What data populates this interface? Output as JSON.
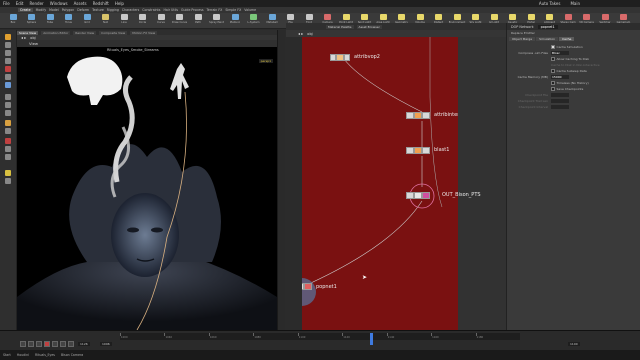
{
  "menubar": {
    "items": [
      "File",
      "Edit",
      "Render",
      "Windows",
      "Assets",
      "Redshift",
      "Help"
    ],
    "right": [
      "Auto Takes",
      "Main"
    ]
  },
  "shelf_tabs": [
    "Create",
    "Modify",
    "Model",
    "Polygon",
    "Deform",
    "Texture",
    "Rigging",
    "Characters",
    "Constraints",
    "Hair Utils",
    "Guide Process",
    "Terrain FX",
    "Simple FX",
    "Volume"
  ],
  "shelf_tools": [
    {
      "label": "Box",
      "color": "#6aa6d8"
    },
    {
      "label": "Sphere",
      "color": "#6aa6d8"
    },
    {
      "label": "Tube",
      "color": "#6aa6d8"
    },
    {
      "label": "Torus",
      "color": "#6aa6d8"
    },
    {
      "label": "Grid",
      "color": "#6aa6d8"
    },
    {
      "label": "Null",
      "color": "#d8c36a"
    },
    {
      "label": "Line",
      "color": "#c8c8c8"
    },
    {
      "label": "Circle",
      "color": "#c8c8c8"
    },
    {
      "label": "Curve",
      "color": "#c8c8c8"
    },
    {
      "label": "Draw Curve",
      "color": "#c8c8c8"
    },
    {
      "label": "Path",
      "color": "#c8c8c8"
    },
    {
      "label": "Spray Paint",
      "color": "#c8c8c8"
    },
    {
      "label": "Platonic",
      "color": "#6aa6d8"
    },
    {
      "label": "L-System",
      "color": "#7ac87a"
    },
    {
      "label": "Metaball",
      "color": "#6aa6d8"
    },
    {
      "label": "File",
      "color": "#c8c8c8"
    },
    {
      "label": "Font",
      "color": "#c8c8c8"
    },
    {
      "label": "Camera",
      "color": "#d86a6a"
    },
    {
      "label": "Point Light",
      "color": "#e8d86a"
    },
    {
      "label": "Spot Light",
      "color": "#e8d86a"
    },
    {
      "label": "Area Light",
      "color": "#e8d86a"
    },
    {
      "label": "Geometry",
      "color": "#e8d86a"
    },
    {
      "label": "Volume",
      "color": "#e8d86a"
    },
    {
      "label": "Distant",
      "color": "#e8d86a"
    },
    {
      "label": "Environment",
      "color": "#e8d86a"
    },
    {
      "label": "Sky Light",
      "color": "#e8d86a"
    },
    {
      "label": "GI Light",
      "color": "#e8d86a"
    },
    {
      "label": "Caustic",
      "color": "#e8d86a"
    },
    {
      "label": "Portal",
      "color": "#e8d86a"
    },
    {
      "label": "Ambient",
      "color": "#e8d86a"
    },
    {
      "label": "Stereo Cam",
      "color": "#d86a6a"
    },
    {
      "label": "VR Camera",
      "color": "#d86a6a"
    },
    {
      "label": "Switcher",
      "color": "#d86a6a"
    },
    {
      "label": "GameCam",
      "color": "#d86a6a"
    }
  ],
  "viewport": {
    "tabs": [
      "Scene View",
      "Animation Editor",
      "Render View",
      "Composite View",
      "Motion FX View"
    ],
    "path": "obj",
    "view_label": "View",
    "title": "Rituals_Eyes_Smoke_Streams",
    "persp": "persp1"
  },
  "network": {
    "tabs": [
      "Material Palette",
      "Asset Browser"
    ],
    "path": "obj",
    "nodes": {
      "attribvop": "attribvop2",
      "attribinterpolate": "attribinterpolate2",
      "blast": "blast1",
      "out": "OUT_Bison_PTS",
      "popnet": "popnet1"
    }
  },
  "params": {
    "type": "DOP Network",
    "name": "popnet1",
    "subheader": "Replace Emitter",
    "tabs": [
      "Object Merge",
      "Simulation",
      "Cache"
    ],
    "rows": [
      {
        "label": "",
        "check": true,
        "text": "Cache Simulation"
      },
      {
        "label": "Compress .sim Files",
        "field": "Blosc"
      },
      {
        "label": "",
        "check": false,
        "text": "Allow Caching To Disk"
      },
      {
        "label": "",
        "text": "Cache to Disk in Non-Interactive",
        "dim": true
      },
      {
        "label": "",
        "check": false,
        "text": "Cache Subsiep Data"
      },
      {
        "label": "Cache Memory (MB)",
        "field": "15000"
      },
      {
        "label": "",
        "check": false,
        "text": "Timeless (No History)"
      },
      {
        "label": "",
        "check": false,
        "text": "Save Checkpoints"
      },
      {
        "label": "Checkpoint File",
        "field": "",
        "dim": true
      },
      {
        "label": "Checkpoint Trail Len",
        "field": "",
        "dim": true
      },
      {
        "label": "Checkpoint Interval",
        "field": "",
        "dim": true
      }
    ]
  },
  "timeline": {
    "start": "1",
    "current": "1096",
    "end": "1100",
    "range_start": "1126",
    "ticks": [
      "1000",
      "1040",
      "1060",
      "1080",
      "1100",
      "1120",
      "1140",
      "1160",
      "1180"
    ]
  },
  "taskbar": {
    "items": [
      "Start",
      "Houdini",
      "Rituals_Eyes",
      "Bison Camera"
    ]
  }
}
